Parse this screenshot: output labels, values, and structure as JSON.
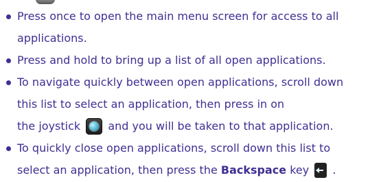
{
  "bullets": [
    {
      "lines": [
        "Press once to open the main menu screen for access to all",
        "applications."
      ]
    },
    {
      "lines": [
        "Press and hold to bring up a list of all open applications."
      ]
    },
    {
      "lines": [
        "To navigate quickly between open applications, scroll down",
        "this list to select an application, then press in on",
        "the joystick",
        "and you will be taken to that application."
      ]
    },
    {
      "lines": [
        "To quickly close open applications, scroll down this list to",
        "select an application, then press the",
        "Backspace",
        "key",
        "."
      ]
    }
  ],
  "icons": {
    "top_fragment": "device-key-icon",
    "joystick": "joystick-icon",
    "backspace": "backspace-key-icon"
  },
  "colors": {
    "text": "#3f2f92",
    "background": "#ffffff"
  }
}
